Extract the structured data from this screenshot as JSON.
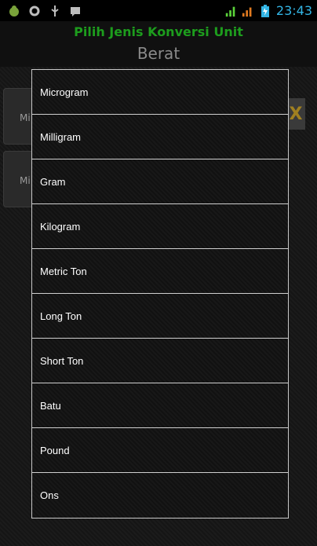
{
  "status_bar": {
    "time": "23:43",
    "left_icons": [
      "android-debug-icon",
      "settings-cog-icon",
      "usb-icon",
      "message-icon"
    ],
    "right_icons": [
      "signal-h-icon",
      "cellular-signal-icon",
      "battery-charging-icon"
    ],
    "accent": "#33b5e5"
  },
  "header": {
    "app_title": "Pilih Jenis Konversi Unit",
    "subtitle": "Berat",
    "title_color": "#1d9d1d"
  },
  "dialog": {
    "items": [
      {
        "label": "Microgram"
      },
      {
        "label": "Milligram"
      },
      {
        "label": "Gram"
      },
      {
        "label": "Kilogram"
      },
      {
        "label": "Metric Ton"
      },
      {
        "label": "Long Ton"
      },
      {
        "label": "Short Ton"
      },
      {
        "label": "Batu"
      },
      {
        "label": "Pound"
      },
      {
        "label": "Ons"
      }
    ]
  },
  "background": {
    "field1_text": "Mi",
    "field2_text": "Mi",
    "clear_label": "X"
  }
}
